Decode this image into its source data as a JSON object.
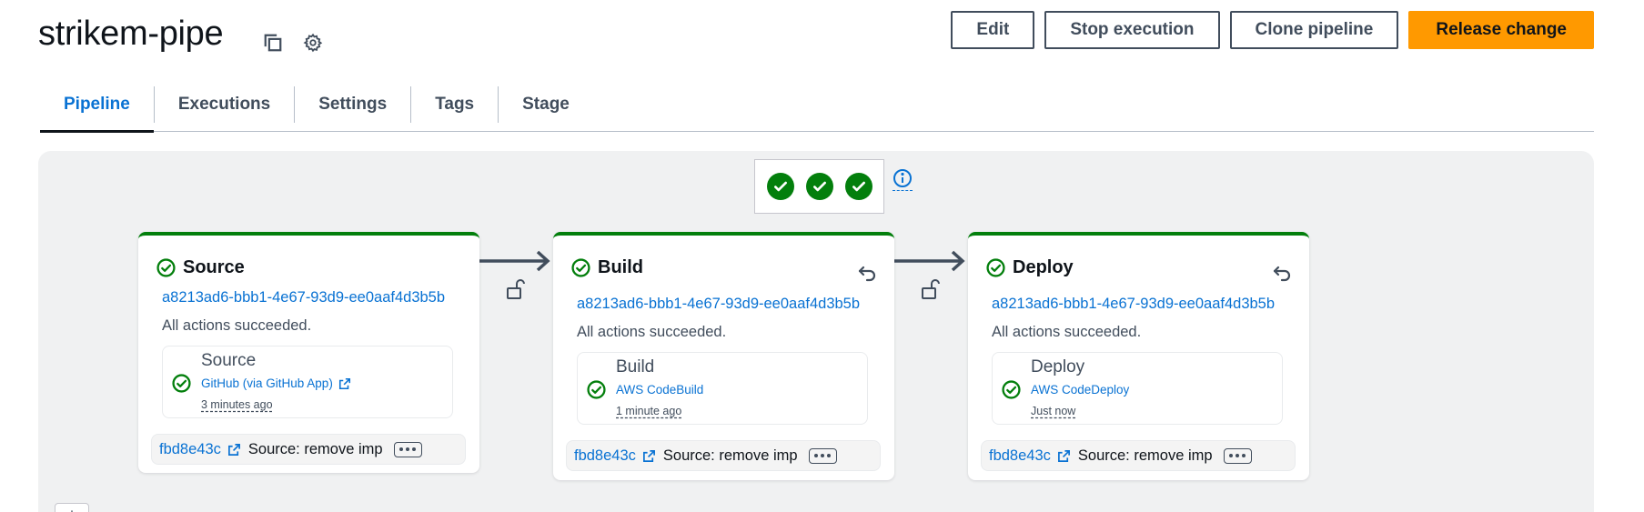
{
  "header": {
    "title": "strikem-pipe",
    "icons": [
      "copy-icon",
      "gear-icon"
    ],
    "buttons": {
      "edit": "Edit",
      "stop": "Stop execution",
      "clone": "Clone pipeline",
      "release": "Release change"
    }
  },
  "tabs": [
    {
      "label": "Pipeline",
      "active": true
    },
    {
      "label": "Executions",
      "active": false
    },
    {
      "label": "Settings",
      "active": false
    },
    {
      "label": "Tags",
      "active": false
    },
    {
      "label": "Stage",
      "active": false
    }
  ],
  "summary": {
    "succeeded_count": 3,
    "info_icon": "info-icon"
  },
  "stages": [
    {
      "name": "Source",
      "execution_id": "a8213ad6-bbb1-4e67-93d9-ee0aaf4d3b5b",
      "status": "All actions succeeded.",
      "has_rollback": false,
      "action": {
        "name": "Source",
        "provider": "GitHub (via GitHub App)",
        "provider_external": true,
        "time": "3 minutes ago"
      },
      "commit": {
        "id": "fbd8e43c",
        "message": "Source: remove imp"
      }
    },
    {
      "name": "Build",
      "execution_id": "a8213ad6-bbb1-4e67-93d9-ee0aaf4d3b5b",
      "status": "All actions succeeded.",
      "has_rollback": true,
      "action": {
        "name": "Build",
        "provider": "AWS CodeBuild",
        "provider_external": false,
        "time": "1 minute ago"
      },
      "commit": {
        "id": "fbd8e43c",
        "message": "Source: remove imp"
      }
    },
    {
      "name": "Deploy",
      "execution_id": "a8213ad6-bbb1-4e67-93d9-ee0aaf4d3b5b",
      "status": "All actions succeeded.",
      "has_rollback": true,
      "action": {
        "name": "Deploy",
        "provider": "AWS CodeDeploy",
        "provider_external": false,
        "time": "Just now"
      },
      "commit": {
        "id": "fbd8e43c",
        "message": "Source: remove imp"
      }
    }
  ],
  "add_stage": {
    "label": "+"
  },
  "colors": {
    "accent": "#0972d3",
    "success": "#037f0c",
    "primary_button": "#ff9900",
    "canvas": "#f0f1f2",
    "text_secondary": "#414d5c"
  }
}
